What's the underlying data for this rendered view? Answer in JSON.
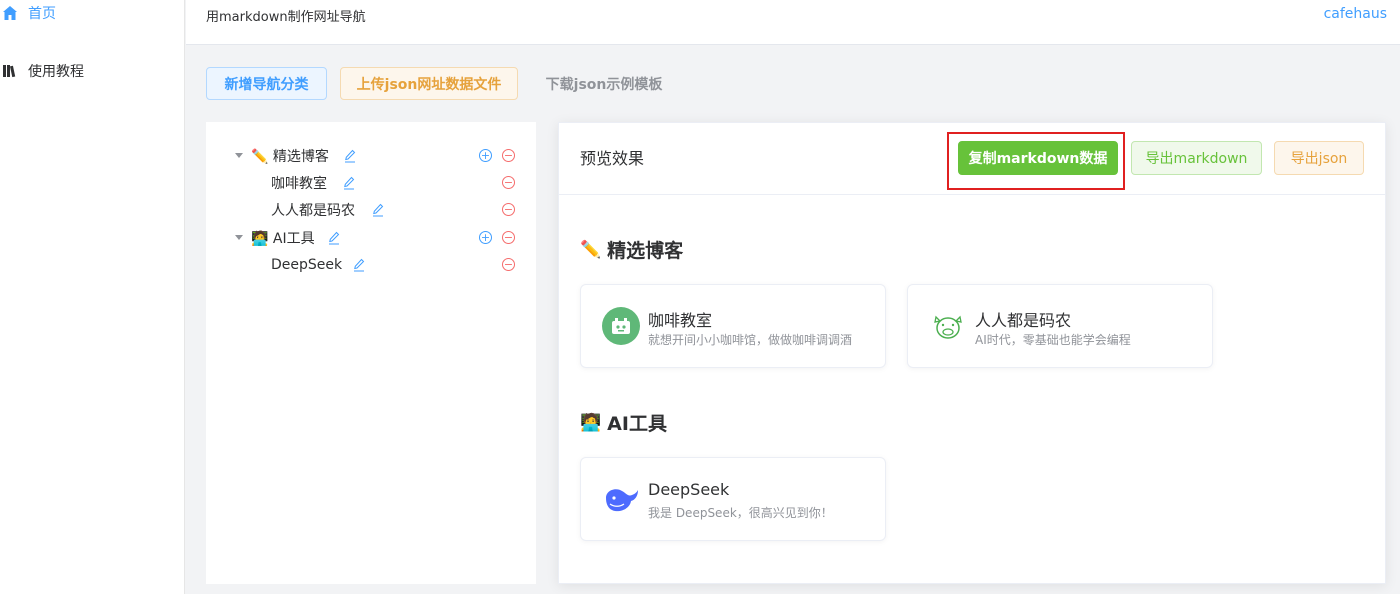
{
  "sidebar": {
    "items": [
      {
        "label": "首页",
        "icon": "home-icon",
        "active": true
      },
      {
        "label": "使用教程",
        "icon": "book-icon",
        "active": false
      }
    ]
  },
  "header": {
    "title": "用markdown制作网址导航",
    "brand": "cafehaus"
  },
  "toolbar": {
    "add_category": "新增导航分类",
    "upload_json": "上传json网址数据文件",
    "download_template": "下载json示例模板"
  },
  "tree": {
    "nodes": [
      {
        "label": "✏️ 精选博客",
        "children": [
          {
            "label": "咖啡教室"
          },
          {
            "label": "人人都是码农"
          }
        ]
      },
      {
        "label": "🧑‍💻 AI工具",
        "children": [
          {
            "label": "DeepSeek"
          }
        ]
      }
    ]
  },
  "preview": {
    "title": "预览效果",
    "copy_markdown": "复制markdown数据",
    "export_markdown": "导出markdown",
    "export_json": "导出json",
    "sections": [
      {
        "emoji": "✏️",
        "title": "精选博客",
        "cards": [
          {
            "name": "咖啡教室",
            "desc": "就想开间小小咖啡馆，做做咖啡调调酒",
            "logo_color": "#5fb878"
          },
          {
            "name": "人人都是码农",
            "desc": "AI时代，零基础也能学会编程",
            "logo_color": "#4caf50"
          }
        ]
      },
      {
        "emoji": "🧑‍💻",
        "title": "AI工具",
        "cards": [
          {
            "name": "DeepSeek",
            "desc": "我是 DeepSeek，很高兴见到你！",
            "logo_color": "#4d6bfe"
          }
        ]
      }
    ]
  },
  "colors": {
    "primary": "#409eff",
    "success": "#67c23a",
    "warning": "#e6a23c",
    "danger": "#f56c6c",
    "highlight": "#e02020"
  }
}
